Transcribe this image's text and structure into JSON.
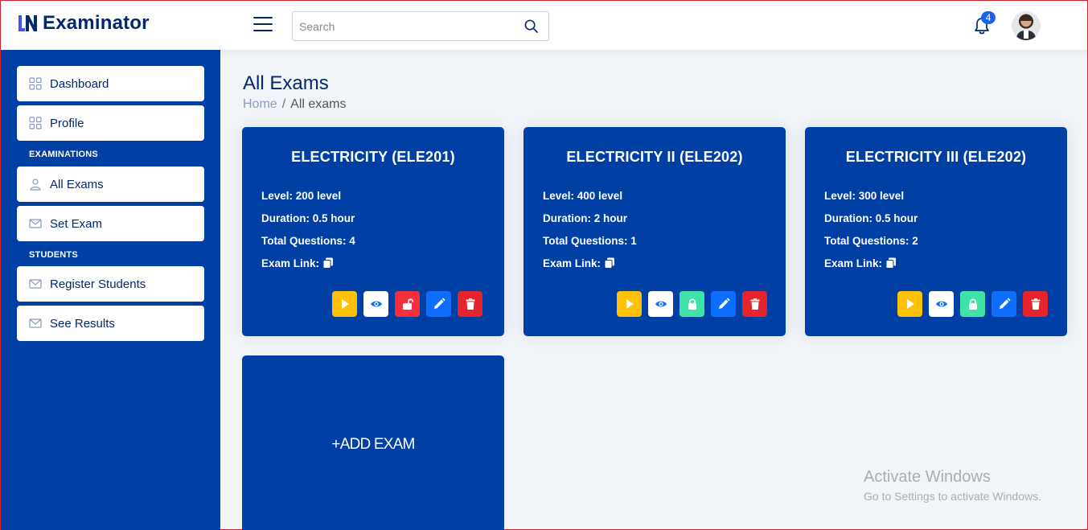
{
  "app": {
    "name": "Examinator",
    "brand_color": "#012970",
    "accent_color": "#0040a5"
  },
  "header": {
    "search_placeholder": "Search",
    "notification_count": "4"
  },
  "sidebar": {
    "items_top": [
      {
        "label": "Dashboard",
        "icon": "grid-icon"
      },
      {
        "label": "Profile",
        "icon": "grid-icon"
      }
    ],
    "section_examinations": "EXAMINATIONS",
    "items_exam": [
      {
        "label": "All Exams",
        "icon": "person-icon"
      },
      {
        "label": "Set Exam",
        "icon": "envelope-icon"
      }
    ],
    "section_students": "STUDENTS",
    "items_students": [
      {
        "label": "Register Students",
        "icon": "envelope-icon"
      },
      {
        "label": "See Results",
        "icon": "envelope-icon"
      }
    ]
  },
  "main": {
    "title": "All Exams",
    "breadcrumb": {
      "home": "Home",
      "separator": "/",
      "current": "All exams"
    },
    "cards": [
      {
        "title": "ELECTRICITY (ELE201)",
        "level": "Level: 200 level",
        "duration": "Duration: 0.5 hour",
        "questions": "Total Questions: 4",
        "link": "Exam Link:",
        "lock_state": "unlocked"
      },
      {
        "title": "ELECTRICITY II (ELE202)",
        "level": "Level: 400 level",
        "duration": "Duration: 2 hour",
        "questions": "Total Questions: 1",
        "link": "Exam Link:",
        "lock_state": "locked"
      },
      {
        "title": "ELECTRICITY III (ELE202)",
        "level": "Level: 300 level",
        "duration": "Duration: 0.5 hour",
        "questions": "Total Questions: 2",
        "link": "Exam Link:",
        "lock_state": "locked"
      }
    ],
    "add_exam_label": "+ADD EXAM"
  },
  "action_colors": {
    "start": "#ffc107",
    "view": "#ffffff",
    "unlocked": "#f5303b",
    "locked": "#3fe3a8",
    "edit": "#0d6efd",
    "delete": "#e5242d"
  },
  "watermark": {
    "line1": "Activate Windows",
    "line2": "Go to Settings to activate Windows."
  }
}
